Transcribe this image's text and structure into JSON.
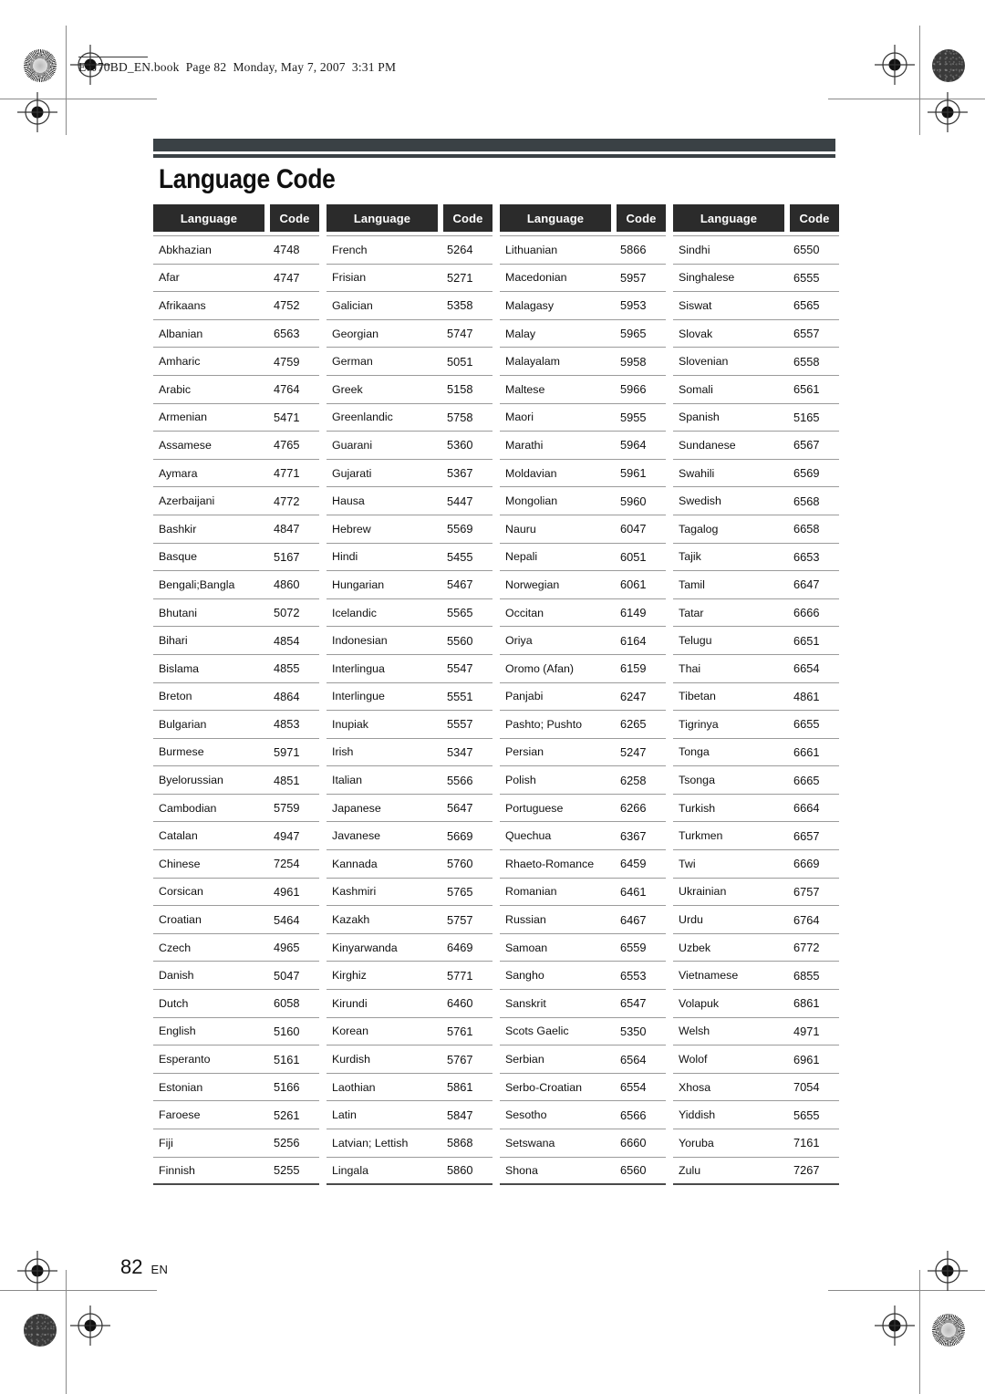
{
  "print_slug": "E7J70BD_EN.book  Page 82  Monday, May 7, 2007  3:31 PM",
  "page_title": "Language Code",
  "footer": {
    "page_number": "82",
    "language_code": "EN"
  },
  "colors": {
    "header_bar": "#2b2b2b",
    "title_band": "#3a4145",
    "rule": "#9b9b9b",
    "text": "#111111"
  },
  "table": {
    "headers": {
      "language": "Language",
      "code": "Code"
    },
    "columns": [
      {
        "rows": [
          {
            "language": "Abkhazian",
            "code": "4748"
          },
          {
            "language": "Afar",
            "code": "4747"
          },
          {
            "language": "Afrikaans",
            "code": "4752"
          },
          {
            "language": "Albanian",
            "code": "6563"
          },
          {
            "language": "Amharic",
            "code": "4759"
          },
          {
            "language": "Arabic",
            "code": "4764"
          },
          {
            "language": "Armenian",
            "code": "5471"
          },
          {
            "language": "Assamese",
            "code": "4765"
          },
          {
            "language": "Aymara",
            "code": "4771"
          },
          {
            "language": "Azerbaijani",
            "code": "4772"
          },
          {
            "language": "Bashkir",
            "code": "4847"
          },
          {
            "language": "Basque",
            "code": "5167"
          },
          {
            "language": "Bengali;Bangla",
            "code": "4860"
          },
          {
            "language": "Bhutani",
            "code": "5072"
          },
          {
            "language": "Bihari",
            "code": "4854"
          },
          {
            "language": "Bislama",
            "code": "4855"
          },
          {
            "language": "Breton",
            "code": "4864"
          },
          {
            "language": "Bulgarian",
            "code": "4853"
          },
          {
            "language": "Burmese",
            "code": "5971"
          },
          {
            "language": "Byelorussian",
            "code": "4851"
          },
          {
            "language": "Cambodian",
            "code": "5759"
          },
          {
            "language": "Catalan",
            "code": "4947"
          },
          {
            "language": "Chinese",
            "code": "7254"
          },
          {
            "language": "Corsican",
            "code": "4961"
          },
          {
            "language": "Croatian",
            "code": "5464"
          },
          {
            "language": "Czech",
            "code": "4965"
          },
          {
            "language": "Danish",
            "code": "5047"
          },
          {
            "language": "Dutch",
            "code": "6058"
          },
          {
            "language": "English",
            "code": "5160"
          },
          {
            "language": "Esperanto",
            "code": "5161"
          },
          {
            "language": "Estonian",
            "code": "5166"
          },
          {
            "language": "Faroese",
            "code": "5261"
          },
          {
            "language": "Fiji",
            "code": "5256"
          },
          {
            "language": "Finnish",
            "code": "5255"
          }
        ]
      },
      {
        "rows": [
          {
            "language": "French",
            "code": "5264"
          },
          {
            "language": "Frisian",
            "code": "5271"
          },
          {
            "language": "Galician",
            "code": "5358"
          },
          {
            "language": "Georgian",
            "code": "5747"
          },
          {
            "language": "German",
            "code": "5051"
          },
          {
            "language": "Greek",
            "code": "5158"
          },
          {
            "language": "Greenlandic",
            "code": "5758"
          },
          {
            "language": "Guarani",
            "code": "5360"
          },
          {
            "language": "Gujarati",
            "code": "5367"
          },
          {
            "language": "Hausa",
            "code": "5447"
          },
          {
            "language": "Hebrew",
            "code": "5569"
          },
          {
            "language": "Hindi",
            "code": "5455"
          },
          {
            "language": "Hungarian",
            "code": "5467"
          },
          {
            "language": "Icelandic",
            "code": "5565"
          },
          {
            "language": "Indonesian",
            "code": "5560"
          },
          {
            "language": "Interlingua",
            "code": "5547"
          },
          {
            "language": "Interlingue",
            "code": "5551"
          },
          {
            "language": "Inupiak",
            "code": "5557"
          },
          {
            "language": "Irish",
            "code": "5347"
          },
          {
            "language": "Italian",
            "code": "5566"
          },
          {
            "language": "Japanese",
            "code": "5647"
          },
          {
            "language": "Javanese",
            "code": "5669"
          },
          {
            "language": "Kannada",
            "code": "5760"
          },
          {
            "language": "Kashmiri",
            "code": "5765"
          },
          {
            "language": "Kazakh",
            "code": "5757"
          },
          {
            "language": "Kinyarwanda",
            "code": "6469"
          },
          {
            "language": "Kirghiz",
            "code": "5771"
          },
          {
            "language": "Kirundi",
            "code": "6460"
          },
          {
            "language": "Korean",
            "code": "5761"
          },
          {
            "language": "Kurdish",
            "code": "5767"
          },
          {
            "language": "Laothian",
            "code": "5861"
          },
          {
            "language": "Latin",
            "code": "5847"
          },
          {
            "language": "Latvian; Lettish",
            "code": "5868"
          },
          {
            "language": "Lingala",
            "code": "5860"
          }
        ]
      },
      {
        "rows": [
          {
            "language": "Lithuanian",
            "code": "5866"
          },
          {
            "language": "Macedonian",
            "code": "5957"
          },
          {
            "language": "Malagasy",
            "code": "5953"
          },
          {
            "language": "Malay",
            "code": "5965"
          },
          {
            "language": "Malayalam",
            "code": "5958"
          },
          {
            "language": "Maltese",
            "code": "5966"
          },
          {
            "language": "Maori",
            "code": "5955"
          },
          {
            "language": "Marathi",
            "code": "5964"
          },
          {
            "language": "Moldavian",
            "code": "5961"
          },
          {
            "language": "Mongolian",
            "code": "5960"
          },
          {
            "language": "Nauru",
            "code": "6047"
          },
          {
            "language": "Nepali",
            "code": "6051"
          },
          {
            "language": "Norwegian",
            "code": "6061"
          },
          {
            "language": "Occitan",
            "code": "6149"
          },
          {
            "language": "Oriya",
            "code": "6164"
          },
          {
            "language": "Oromo (Afan)",
            "code": "6159"
          },
          {
            "language": "Panjabi",
            "code": "6247"
          },
          {
            "language": "Pashto; Pushto",
            "code": "6265"
          },
          {
            "language": "Persian",
            "code": "5247"
          },
          {
            "language": "Polish",
            "code": "6258"
          },
          {
            "language": "Portuguese",
            "code": "6266"
          },
          {
            "language": "Quechua",
            "code": "6367"
          },
          {
            "language": "Rhaeto-Romance",
            "code": "6459"
          },
          {
            "language": "Romanian",
            "code": "6461"
          },
          {
            "language": "Russian",
            "code": "6467"
          },
          {
            "language": "Samoan",
            "code": "6559"
          },
          {
            "language": "Sangho",
            "code": "6553"
          },
          {
            "language": "Sanskrit",
            "code": "6547"
          },
          {
            "language": "Scots Gaelic",
            "code": "5350"
          },
          {
            "language": "Serbian",
            "code": "6564"
          },
          {
            "language": "Serbo-Croatian",
            "code": "6554"
          },
          {
            "language": "Sesotho",
            "code": "6566"
          },
          {
            "language": "Setswana",
            "code": "6660"
          },
          {
            "language": "Shona",
            "code": "6560"
          }
        ]
      },
      {
        "rows": [
          {
            "language": "Sindhi",
            "code": "6550"
          },
          {
            "language": "Singhalese",
            "code": "6555"
          },
          {
            "language": "Siswat",
            "code": "6565"
          },
          {
            "language": "Slovak",
            "code": "6557"
          },
          {
            "language": "Slovenian",
            "code": "6558"
          },
          {
            "language": "Somali",
            "code": "6561"
          },
          {
            "language": "Spanish",
            "code": "5165"
          },
          {
            "language": "Sundanese",
            "code": "6567"
          },
          {
            "language": "Swahili",
            "code": "6569"
          },
          {
            "language": "Swedish",
            "code": "6568"
          },
          {
            "language": "Tagalog",
            "code": "6658"
          },
          {
            "language": "Tajik",
            "code": "6653"
          },
          {
            "language": "Tamil",
            "code": "6647"
          },
          {
            "language": "Tatar",
            "code": "6666"
          },
          {
            "language": "Telugu",
            "code": "6651"
          },
          {
            "language": "Thai",
            "code": "6654"
          },
          {
            "language": "Tibetan",
            "code": "4861"
          },
          {
            "language": "Tigrinya",
            "code": "6655"
          },
          {
            "language": "Tonga",
            "code": "6661"
          },
          {
            "language": "Tsonga",
            "code": "6665"
          },
          {
            "language": "Turkish",
            "code": "6664"
          },
          {
            "language": "Turkmen",
            "code": "6657"
          },
          {
            "language": "Twi",
            "code": "6669"
          },
          {
            "language": "Ukrainian",
            "code": "6757"
          },
          {
            "language": "Urdu",
            "code": "6764"
          },
          {
            "language": "Uzbek",
            "code": "6772"
          },
          {
            "language": "Vietnamese",
            "code": "6855"
          },
          {
            "language": "Volapuk",
            "code": "6861"
          },
          {
            "language": "Welsh",
            "code": "4971"
          },
          {
            "language": "Wolof",
            "code": "6961"
          },
          {
            "language": "Xhosa",
            "code": "7054"
          },
          {
            "language": "Yiddish",
            "code": "5655"
          },
          {
            "language": "Yoruba",
            "code": "7161"
          },
          {
            "language": "Zulu",
            "code": "7267"
          }
        ]
      }
    ]
  }
}
